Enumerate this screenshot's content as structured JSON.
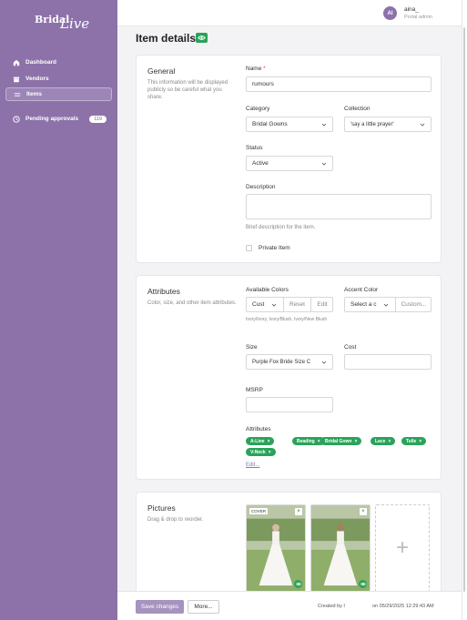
{
  "brand": {
    "logo_bridal": "Bridal",
    "logo_live": "Live"
  },
  "sidebar": {
    "items": [
      {
        "label": "Dashboard",
        "icon": "home-icon"
      },
      {
        "label": "Vendors",
        "icon": "store-icon"
      },
      {
        "label": "Items",
        "icon": "tags-icon",
        "active": true
      },
      {
        "label": "Pending approvals",
        "icon": "clock-icon",
        "badge": "119"
      }
    ]
  },
  "user": {
    "initials": "AI",
    "name": "aina_",
    "role": "Portal admin"
  },
  "page": {
    "title": "Item details",
    "visibility_icon": "eye-icon"
  },
  "general": {
    "title": "General",
    "description": "This information will be displayed publicly so be careful what you share.",
    "name_label": "Name",
    "name_required": "*",
    "name_value": "rumours",
    "category_label": "Category",
    "category_value": "Bridal Gowns",
    "collection_label": "Collection",
    "collection_value": "'say a little prayer'",
    "status_label": "Status",
    "status_value": "Active",
    "description_label": "Description",
    "description_help": "Brief description for the item.",
    "private_label": "Private Item"
  },
  "attributes": {
    "title": "Attributes",
    "description": "Color, size, and other item attributes.",
    "available_colors_label": "Available Colors",
    "available_colors_value": "Cust",
    "reset_label": "Reset",
    "edit_label": "Edit",
    "colors_help": "Ivory/Ivory, Ivory/Blush, Ivory/New Blush",
    "accent_color_label": "Accent Color",
    "accent_select_value": "Select a c",
    "accent_custom_label": "Custom...",
    "size_label": "Size",
    "size_value": "Purple Fox Bride Size C",
    "cost_label": "Cost",
    "msrp_label": "MSRP",
    "attributes_label": "Attributes",
    "tags": [
      "A-Line",
      "Beading",
      "Bridal Gown",
      "Lace",
      "Tulle",
      "V-Neck"
    ],
    "tags_edit_label": "Edit..."
  },
  "pictures": {
    "title": "Pictures",
    "description": "Drag & drop to reorder.",
    "cover_label": "COVER",
    "close_glyph": "×",
    "add_glyph": "+"
  },
  "footer": {
    "save_label": "Save changes",
    "more_label": "More...",
    "created_by": "Created by I",
    "created_on": "on 05/29/2025 12:29:43 AM"
  },
  "colors": {
    "brand_purple": "#8c72a9",
    "status_green": "#2aa35a"
  }
}
